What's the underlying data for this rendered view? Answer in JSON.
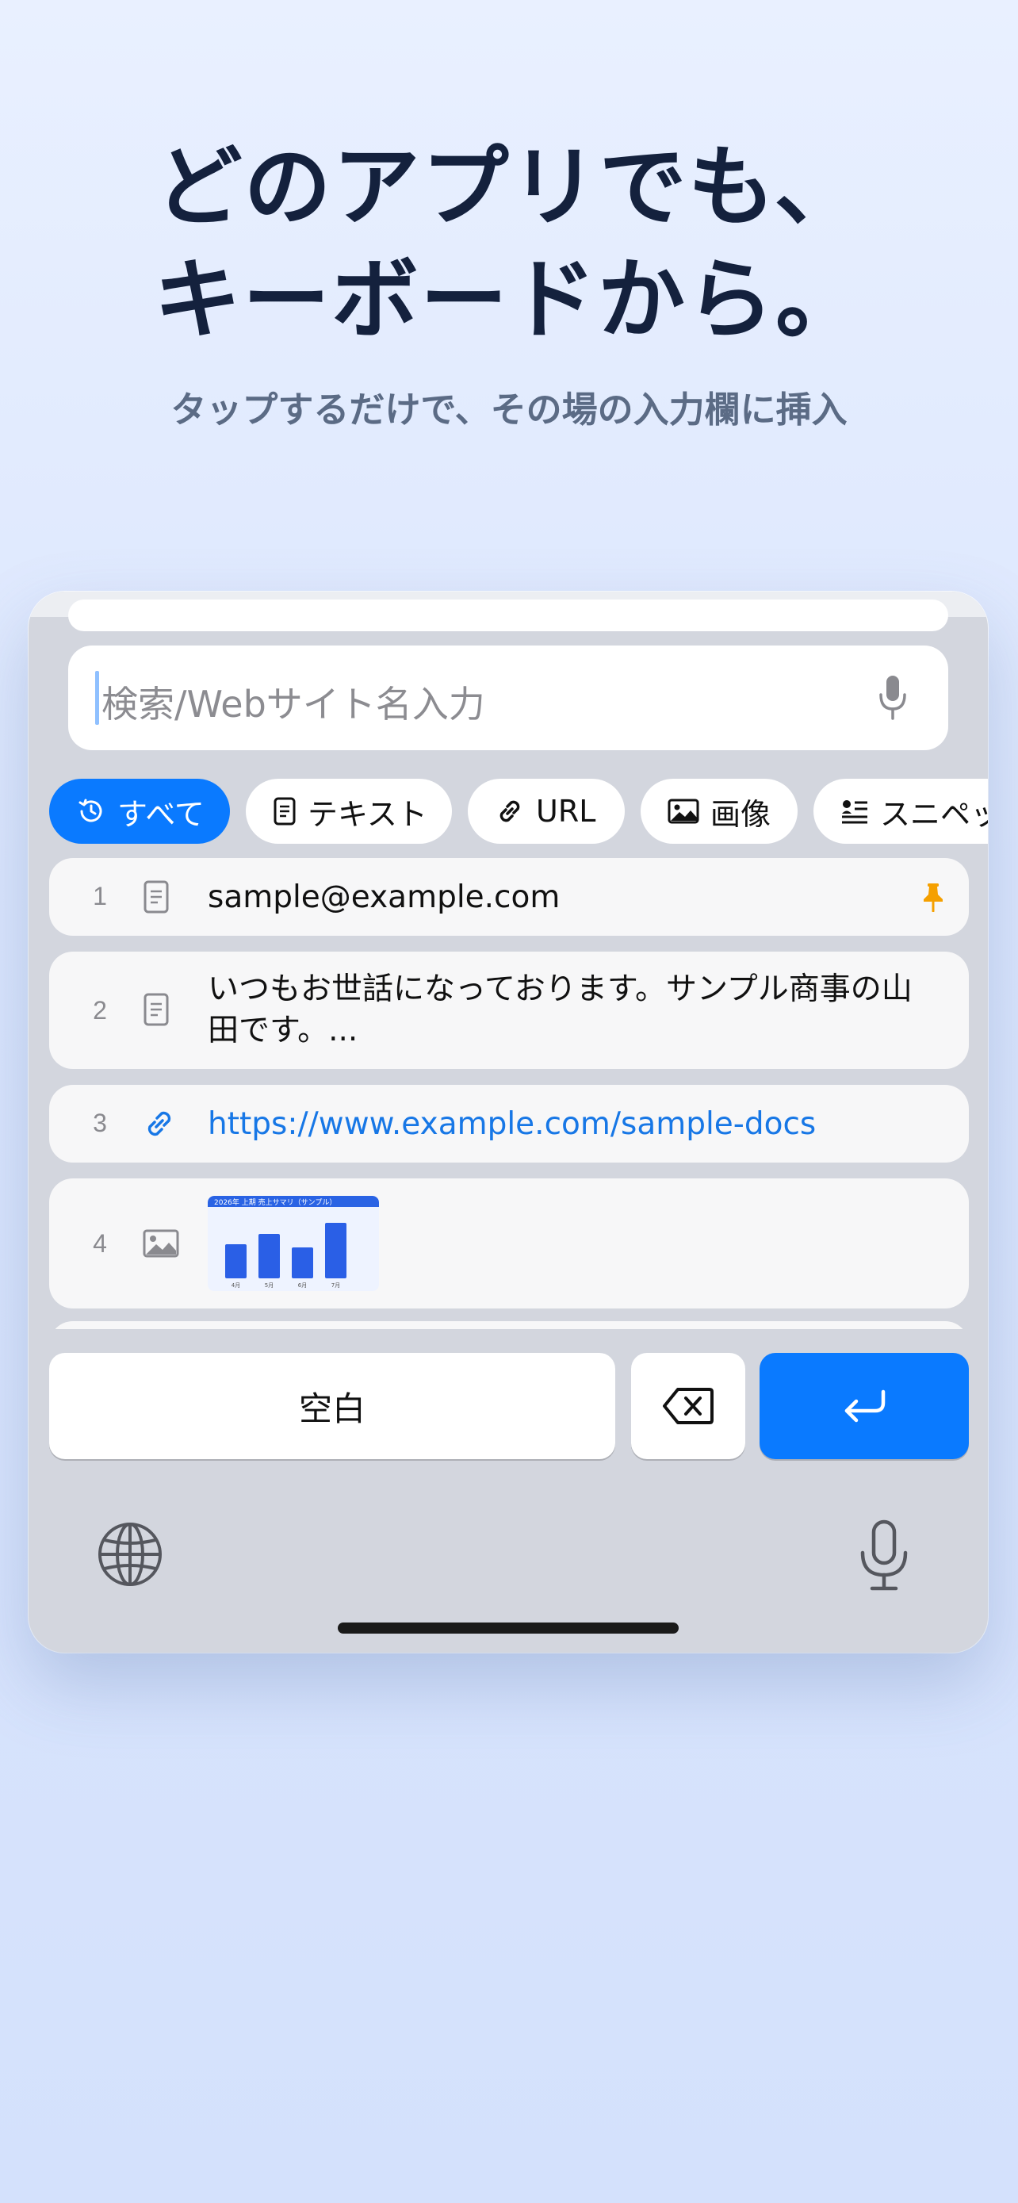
{
  "hero": {
    "title_line1": "どのアプリでも、",
    "title_line2": "キーボードから。",
    "subtitle": "タップするだけで、その場の入力欄に挿入"
  },
  "keyboard": {
    "search": {
      "placeholder": "検索/Webサイト名入力",
      "mic_icon": "mic-icon"
    },
    "filters": [
      {
        "label": "すべて",
        "icon": "history-icon",
        "selected": true
      },
      {
        "label": "テキスト",
        "icon": "document-icon",
        "selected": false
      },
      {
        "label": "URL",
        "icon": "link-icon",
        "selected": false
      },
      {
        "label": "画像",
        "icon": "photo-icon",
        "selected": false
      },
      {
        "label": "スニペッ",
        "icon": "snippet-icon",
        "selected": false
      }
    ],
    "items": [
      {
        "index": "1",
        "type_icon": "document-icon",
        "text": "sample@example.com",
        "pinned": true
      },
      {
        "index": "2",
        "type_icon": "document-icon",
        "text_line1": "いつもお世話になっております。サンプル商事の山",
        "text_line2": "田です。..."
      },
      {
        "index": "3",
        "type_icon": "link-icon",
        "text": "https://www.example.com/sample-docs"
      },
      {
        "index": "4",
        "type_icon": "photo-icon",
        "thumbnail": {
          "title": "2026年 上期 売上サマリ（サンプル）",
          "bars": [
            {
              "label": "4月",
              "value": 0.55
            },
            {
              "label": "5月",
              "value": 0.72
            },
            {
              "label": "6月",
              "value": 0.5
            },
            {
              "label": "7月",
              "value": 0.9
            }
          ]
        }
      }
    ],
    "keys": {
      "space": "空白",
      "delete_icon": "delete-backward-icon",
      "return_icon": "return-arrow-icon"
    },
    "bottom": {
      "globe_icon": "globe-icon",
      "dictation_icon": "mic-icon"
    },
    "colors": {
      "accent": "#0a7aff",
      "link": "#1777e6",
      "pin": "#f5a000",
      "headline": "#14213d",
      "subtitle": "#5b6b85"
    }
  }
}
